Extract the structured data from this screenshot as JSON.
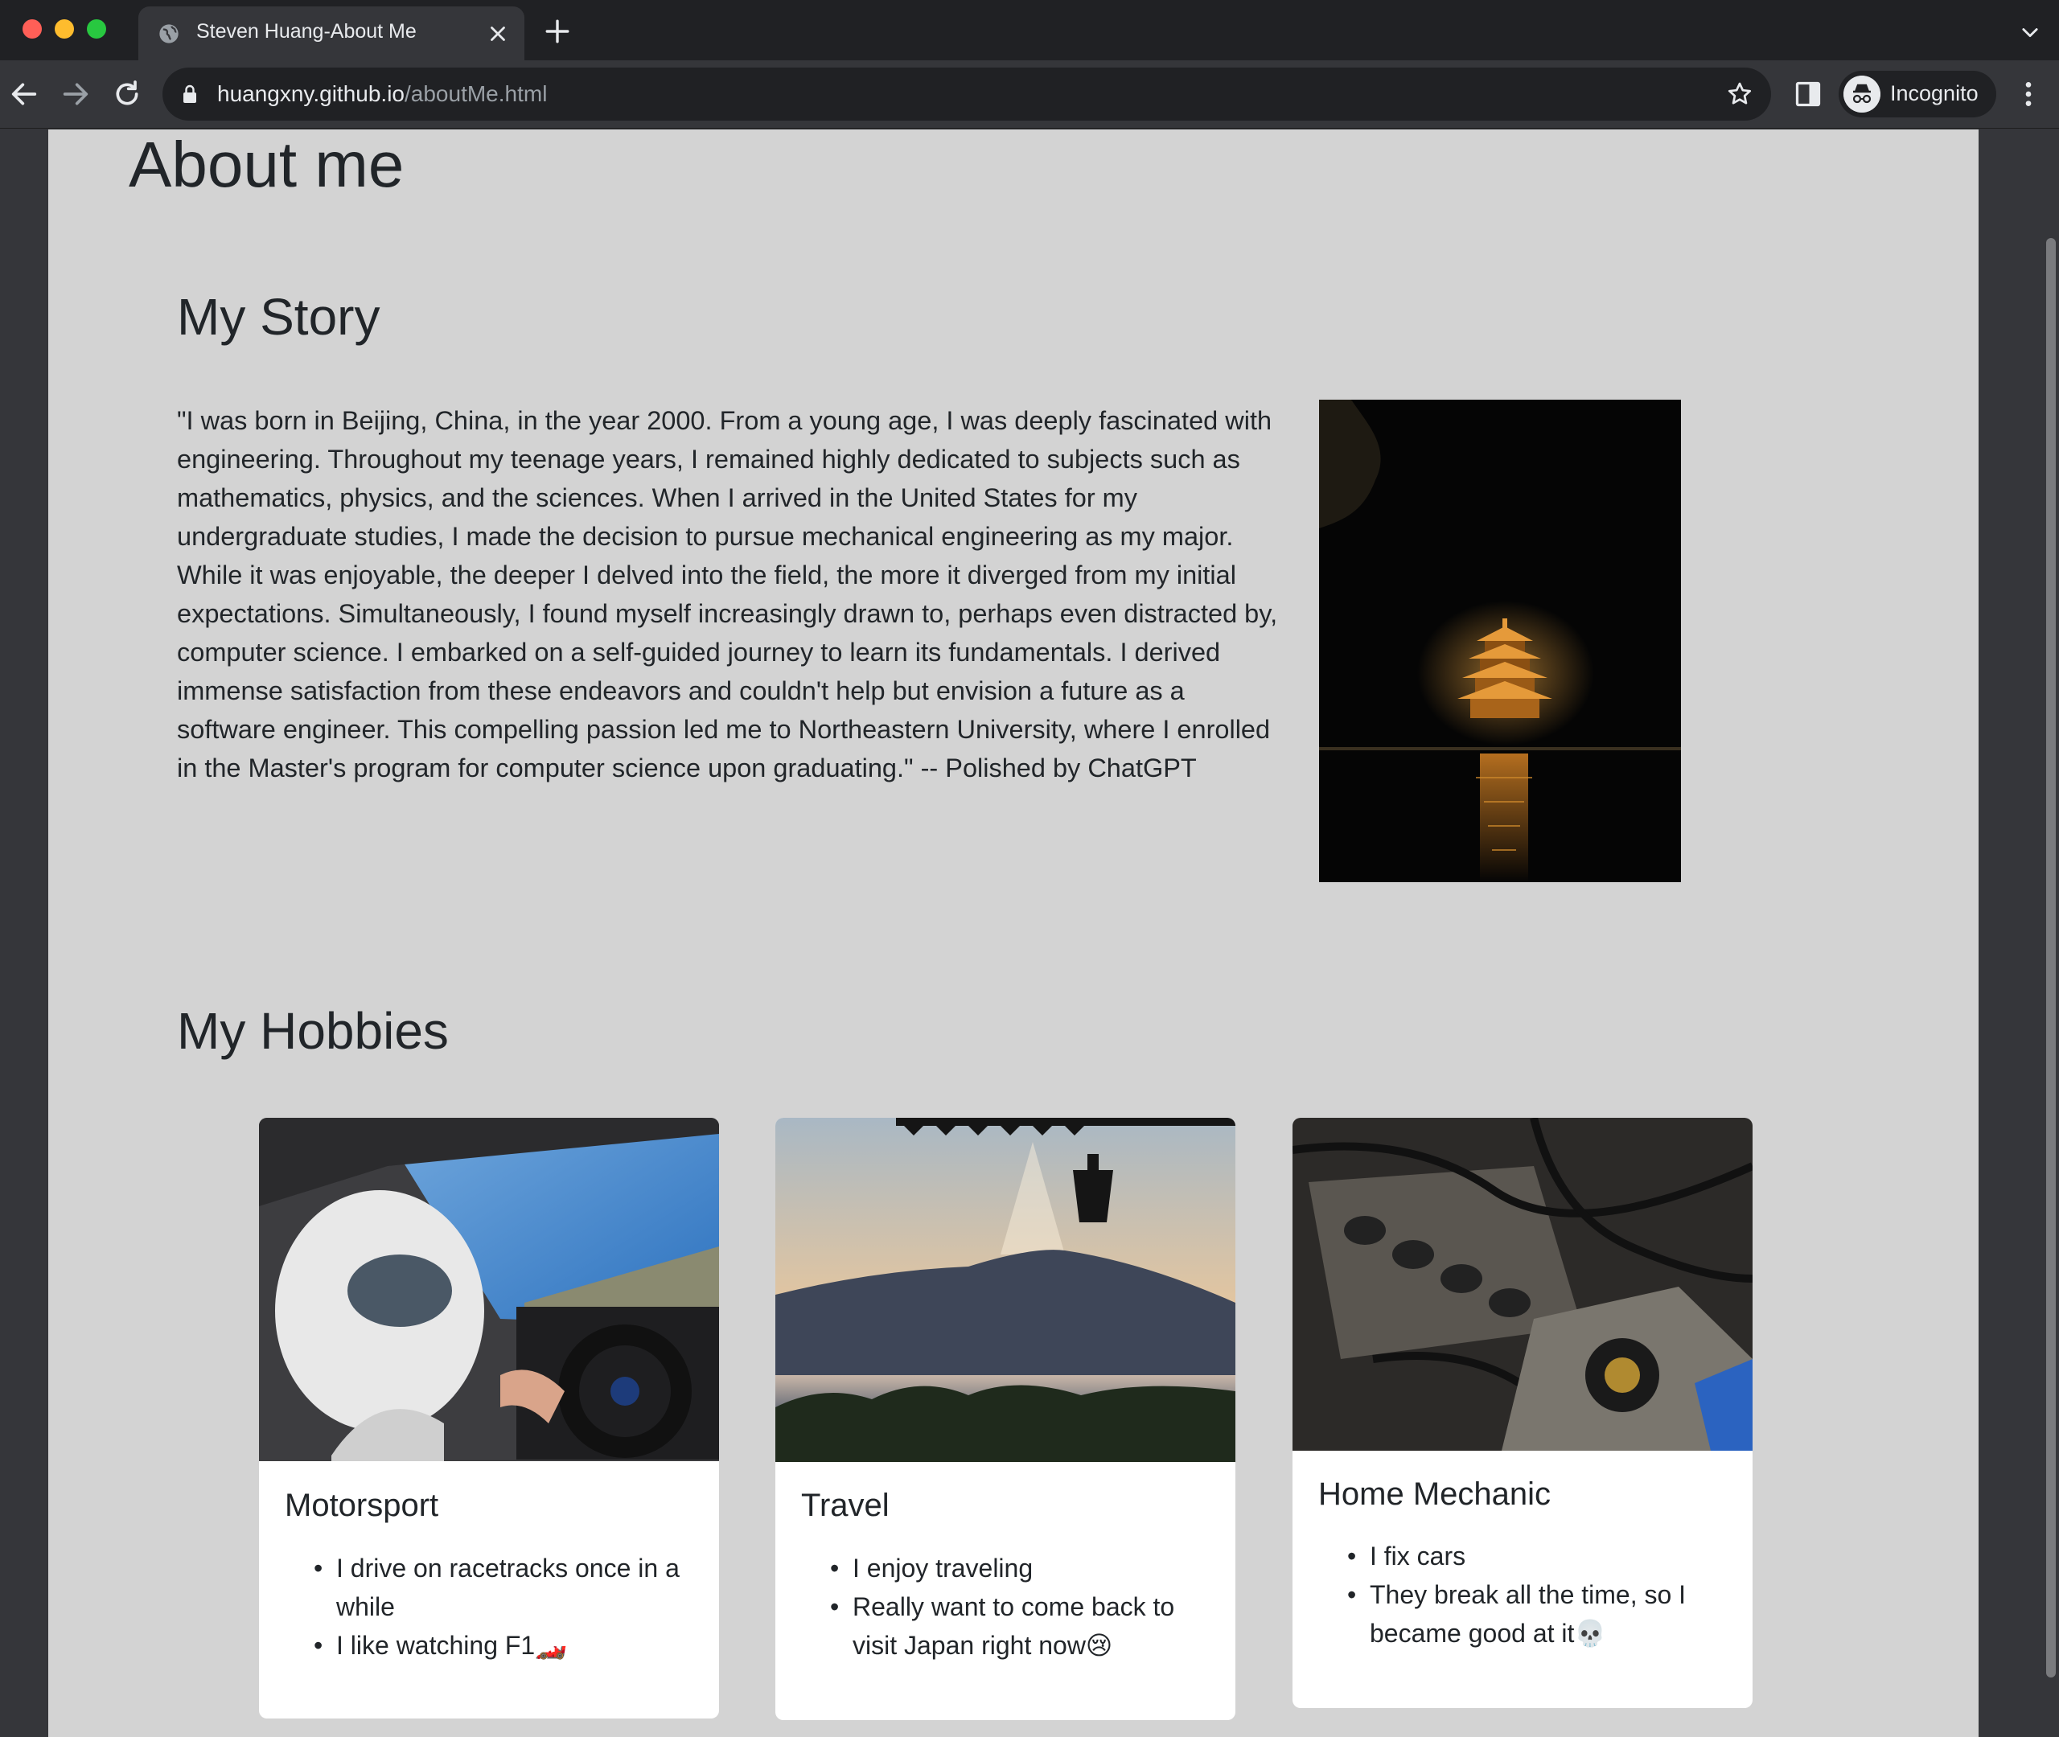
{
  "browser": {
    "tab_title": "Steven Huang-About Me",
    "url_host": "huangxny.github.io",
    "url_path": "/aboutMe.html",
    "profile_label": "Incognito",
    "icons": [
      "globe-icon",
      "close-icon",
      "plus-icon",
      "chevron-down-icon",
      "back-arrow-icon",
      "forward-arrow-icon",
      "reload-icon",
      "lock-icon",
      "star-icon",
      "side-panel-icon",
      "incognito-icon",
      "more-vert-icon"
    ]
  },
  "page": {
    "title": "About me",
    "story": {
      "heading": "My Story",
      "text": "\"I was born in Beijing, China, in the year 2000. From a young age, I was deeply fascinated with engineering. Throughout my teenage years, I remained highly dedicated to subjects such as mathematics, physics, and the sciences. When I arrived in the United States for my undergraduate studies, I made the decision to pursue mechanical engineering as my major. While it was enjoyable, the deeper I delved into the field, the more it diverged from my initial expectations. Simultaneously, I found myself increasingly drawn to, perhaps even distracted by, computer science. I embarked on a self-guided journey to learn its fundamentals. I derived immense satisfaction from these endeavors and couldn't help but envision a future as a software engineer. This compelling passion led me to Northeastern University, where I enrolled in the Master's program for computer science upon graduating.\" -- Polished by ChatGPT"
    },
    "hobbies": {
      "heading": "My Hobbies",
      "cards": [
        {
          "title": "Motorsport",
          "items": [
            "I drive on racetracks once in a while",
            "I like watching F1🏎️"
          ]
        },
        {
          "title": "Travel",
          "items": [
            "I enjoy traveling",
            "Really want to come back to visit Japan right now😢"
          ]
        },
        {
          "title": "Home Mechanic",
          "items": [
            "I fix cars",
            "They break all the time, so I became good at it💀"
          ]
        }
      ]
    }
  },
  "colors": {
    "page_background": "#d3d3d3",
    "card_background": "#ffffff",
    "text": "#212529",
    "chrome_dark": "#202124",
    "chrome_mid": "#35363a"
  }
}
